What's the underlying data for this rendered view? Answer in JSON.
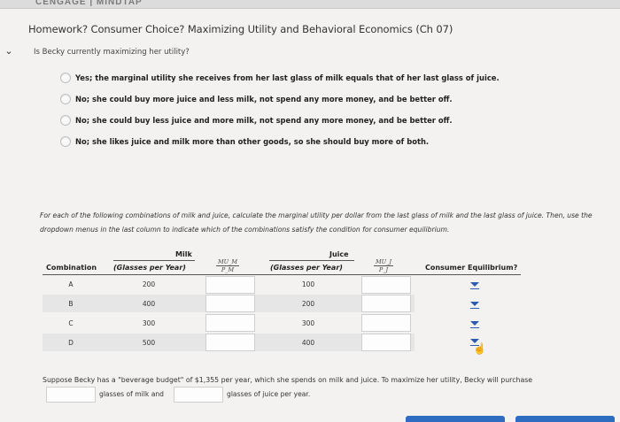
{
  "header": {
    "logo_text": "CENGAGE | MINDTAP",
    "title": "Homework? Consumer Choice? Maximizing Utility and Behavioral Economics (Ch 07)"
  },
  "question1": {
    "prompt": "Is Becky currently maximizing her utility?",
    "options": [
      "Yes; the marginal utility she receives from her last glass of milk equals that of her last glass of juice.",
      "No; she could buy more juice and less milk, not spend any more money, and be better off.",
      "No; she could buy less juice and more milk, not spend any more money, and be better off.",
      "No; she likes juice and milk more than other goods, so she should buy more of both."
    ]
  },
  "instructions": "For each of the following combinations of milk and juice, calculate the marginal utility per dollar from the last glass of milk and the last glass of juice. Then, use the dropdown menus in the last column to indicate which of the combinations satisfy the condition for consumer equilibrium.",
  "table": {
    "group_milk": "Milk",
    "group_juice": "Juice",
    "col_combination": "Combination",
    "col_milk_qty": "(Glasses per Year)",
    "col_mu_m_num": "MU_M",
    "col_mu_m_den": "P_M",
    "col_juice_qty": "(Glasses per Year)",
    "col_mu_j_num": "MU_J",
    "col_mu_j_den": "P_J",
    "col_equilibrium": "Consumer Equilibrium?",
    "rows": [
      {
        "combo": "A",
        "milk": "200",
        "juice": "100"
      },
      {
        "combo": "B",
        "milk": "400",
        "juice": "200"
      },
      {
        "combo": "C",
        "milk": "300",
        "juice": "300"
      },
      {
        "combo": "D",
        "milk": "500",
        "juice": "400"
      }
    ]
  },
  "budget": {
    "text": "Suppose Becky has a \"beverage budget\" of $1,355 per year, which she spends on milk and juice. To maximize her utility, Becky will purchase",
    "label_milk": "glasses of milk and",
    "label_juice": "glasses of juice per year."
  },
  "colors": {
    "accent": "#2d5bb0",
    "button": "#2d6cc0",
    "row_alt": "#e6e6e6"
  }
}
